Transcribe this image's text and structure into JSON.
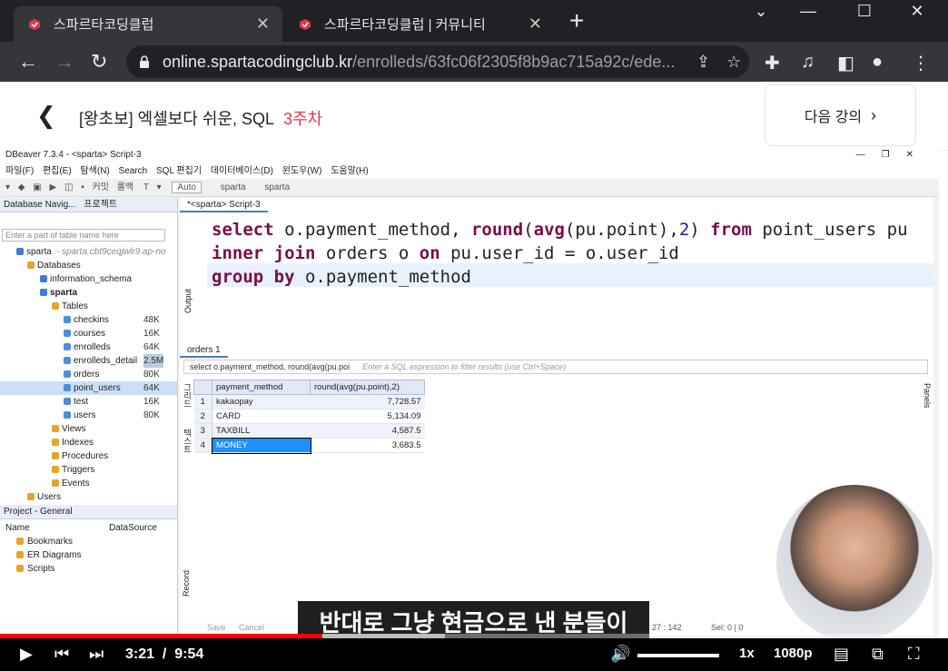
{
  "browser": {
    "tabs": [
      {
        "title": "스파르타코딩클럽",
        "active": true
      },
      {
        "title": "스파르타코딩클럽 | 커뮤니티",
        "active": false
      }
    ],
    "url_host": "online.spartacodingclub.kr",
    "url_path": "/enrolleds/63fc06f2305f8b9ac715a92c/ede..."
  },
  "page": {
    "course_title": "[왕초보] 엑셀보다 쉬운, SQL",
    "week": "3주차",
    "next_lecture": "다음 강의"
  },
  "dbeaver": {
    "title": "DBeaver 7.3.4 - <sparta> Script-3",
    "menu": [
      "파일(F)",
      "편집(E)",
      "탐색(N)",
      "Search",
      "SQL 편집기",
      "데이터베이스(D)",
      "윈도우(W)",
      "도움말(H)"
    ],
    "toolbar": {
      "mode": "Auto",
      "conn1": "sparta",
      "conn2": "sparta",
      "commit": "커밋",
      "rollback": "롤백"
    },
    "nav_tabs": [
      "Database Navig...",
      "프로젝트"
    ],
    "filter_placeholder": "Enter a part of table name here",
    "tree": {
      "connection": "sparta",
      "connection_host": "- sparta.cbt9ceqjwlr9.ap-no",
      "databases": "Databases",
      "schema1": "information_schema",
      "schema2": "sparta",
      "tables_label": "Tables",
      "tables": [
        {
          "name": "checkins",
          "size": "48K"
        },
        {
          "name": "courses",
          "size": "16K"
        },
        {
          "name": "enrolleds",
          "size": "64K"
        },
        {
          "name": "enrolleds_detail",
          "size": "2.5M"
        },
        {
          "name": "orders",
          "size": "80K"
        },
        {
          "name": "point_users",
          "size": "64K"
        },
        {
          "name": "test",
          "size": "16K"
        },
        {
          "name": "users",
          "size": "80K"
        }
      ],
      "folders": [
        "Views",
        "Indexes",
        "Procedures",
        "Triggers",
        "Events"
      ],
      "users": "Users"
    },
    "project": {
      "title": "Project - General",
      "col_name": "Name",
      "col_ds": "DataSource",
      "items": [
        "Bookmarks",
        "ER Diagrams",
        "Scripts"
      ]
    },
    "editor_tab": "*<sparta> Script-3",
    "sql": {
      "l1_kw1": "select",
      "l1_a": " o.payment_method, ",
      "l1_kw2": "round",
      "l1_b": "(",
      "l1_kw3": "avg",
      "l1_c": "(pu.point),",
      "l1_num": "2",
      "l1_d": ") ",
      "l1_kw4": "from",
      "l1_e": " point_users pu",
      "l2_kw1": "inner join",
      "l2_a": " orders o ",
      "l2_kw2": "on",
      "l2_b": " pu.user_id = o.user_id",
      "l3_kw1": "group by",
      "l3_a": " o.payment_method"
    },
    "result_tab": "orders 1",
    "result_sql": "select o.payment_method, round(avg(pu.poi",
    "filter_hint": "Enter a SQL expression to filter results (use Ctrl+Space)",
    "columns": [
      "payment_method",
      "round(avg(pu.point),2)"
    ],
    "rows": [
      {
        "n": "1",
        "method": "kakaopay",
        "avg": "7,728.57"
      },
      {
        "n": "2",
        "method": "CARD",
        "avg": "5,134.09"
      },
      {
        "n": "3",
        "method": "TAXBILL",
        "avg": "4,587.5"
      },
      {
        "n": "4",
        "method": "MONEY",
        "avg": "3,683.5"
      }
    ],
    "side_labels": {
      "grid": "그리드",
      "text": "텍스트",
      "output": "Output",
      "record": "Record",
      "panels": "Panels"
    },
    "bottom": {
      "save": "Save",
      "cancel": "Cancel",
      "pos": "27 : 142",
      "sel": "Sel: 0 | 0"
    }
  },
  "video": {
    "subtitle": "반대로 그냥 현금으로 낸 분들이",
    "current": "3:21",
    "total": "9:54",
    "speed": "1x",
    "quality": "1080p",
    "progress": 0.34
  }
}
